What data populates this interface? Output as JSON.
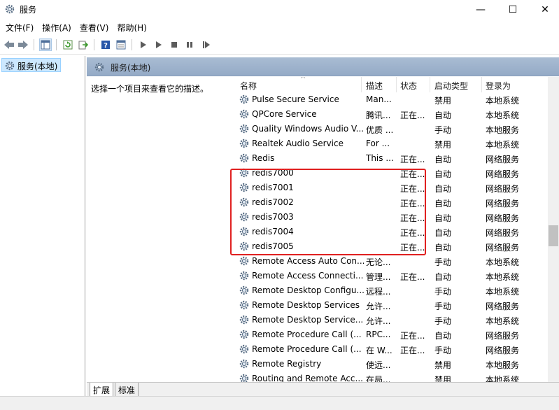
{
  "window": {
    "title": "服务",
    "icon": "gear-icon",
    "minimize": "—",
    "maximize": "☐",
    "close": "✕"
  },
  "menu": [
    "文件(F)",
    "操作(A)",
    "查看(V)",
    "帮助(H)"
  ],
  "toolbar": {
    "icons": [
      "back-arrow-icon",
      "forward-arrow-icon",
      "show-hide-tree-icon",
      "refresh-icon",
      "export-list-icon",
      "help-icon",
      "properties-icon",
      "start-service-icon",
      "start-service-alt-icon",
      "stop-service-icon",
      "pause-service-icon",
      "resume-service-icon"
    ]
  },
  "tree": {
    "selected_label": "服务(本地)"
  },
  "right_pane": {
    "header": "服务(本地)",
    "description_hint": "选择一个项目来查看它的描述。"
  },
  "table": {
    "columns": [
      "名称",
      "描述",
      "状态",
      "启动类型",
      "登录为"
    ],
    "sort_indicator": "^",
    "rows": [
      {
        "name": "Pulse Secure Service",
        "desc": "Man...",
        "state": "",
        "start": "禁用",
        "logon": "本地系统"
      },
      {
        "name": "QPCore Service",
        "desc": "腾讯...",
        "state": "正在...",
        "start": "自动",
        "logon": "本地系统"
      },
      {
        "name": "Quality Windows Audio V...",
        "desc": "优质 ...",
        "state": "",
        "start": "手动",
        "logon": "本地服务"
      },
      {
        "name": "Realtek Audio Service",
        "desc": "For ...",
        "state": "",
        "start": "禁用",
        "logon": "本地系统"
      },
      {
        "name": "Redis",
        "desc": "This ...",
        "state": "正在...",
        "start": "自动",
        "logon": "网络服务"
      },
      {
        "name": "redis7000",
        "desc": "",
        "state": "正在...",
        "start": "自动",
        "logon": "网络服务"
      },
      {
        "name": "redis7001",
        "desc": "",
        "state": "正在...",
        "start": "自动",
        "logon": "网络服务"
      },
      {
        "name": "redis7002",
        "desc": "",
        "state": "正在...",
        "start": "自动",
        "logon": "网络服务"
      },
      {
        "name": "redis7003",
        "desc": "",
        "state": "正在...",
        "start": "自动",
        "logon": "网络服务"
      },
      {
        "name": "redis7004",
        "desc": "",
        "state": "正在...",
        "start": "自动",
        "logon": "网络服务"
      },
      {
        "name": "redis7005",
        "desc": "",
        "state": "正在...",
        "start": "自动",
        "logon": "网络服务"
      },
      {
        "name": "Remote Access Auto Con...",
        "desc": "无论...",
        "state": "",
        "start": "手动",
        "logon": "本地系统"
      },
      {
        "name": "Remote Access Connecti...",
        "desc": "管理...",
        "state": "正在...",
        "start": "自动",
        "logon": "本地系统"
      },
      {
        "name": "Remote Desktop Configu...",
        "desc": "远程...",
        "state": "",
        "start": "手动",
        "logon": "本地系统"
      },
      {
        "name": "Remote Desktop Services",
        "desc": "允许...",
        "state": "",
        "start": "手动",
        "logon": "网络服务"
      },
      {
        "name": "Remote Desktop Service...",
        "desc": "允许...",
        "state": "",
        "start": "手动",
        "logon": "本地系统"
      },
      {
        "name": "Remote Procedure Call (...",
        "desc": "RPC...",
        "state": "正在...",
        "start": "自动",
        "logon": "网络服务"
      },
      {
        "name": "Remote Procedure Call (...",
        "desc": "在 W...",
        "state": "正在...",
        "start": "手动",
        "logon": "网络服务"
      },
      {
        "name": "Remote Registry",
        "desc": "使远...",
        "state": "",
        "start": "禁用",
        "logon": "本地服务"
      },
      {
        "name": "Routing and Remote Acc...",
        "desc": "在局...",
        "state": "",
        "start": "禁用",
        "logon": "本地系统"
      }
    ]
  },
  "tabs": [
    "扩展",
    "标准"
  ],
  "colors": {
    "highlight_box": "#e02020",
    "selection": "#cce8ff",
    "pane_header": "#a9bcd3"
  }
}
